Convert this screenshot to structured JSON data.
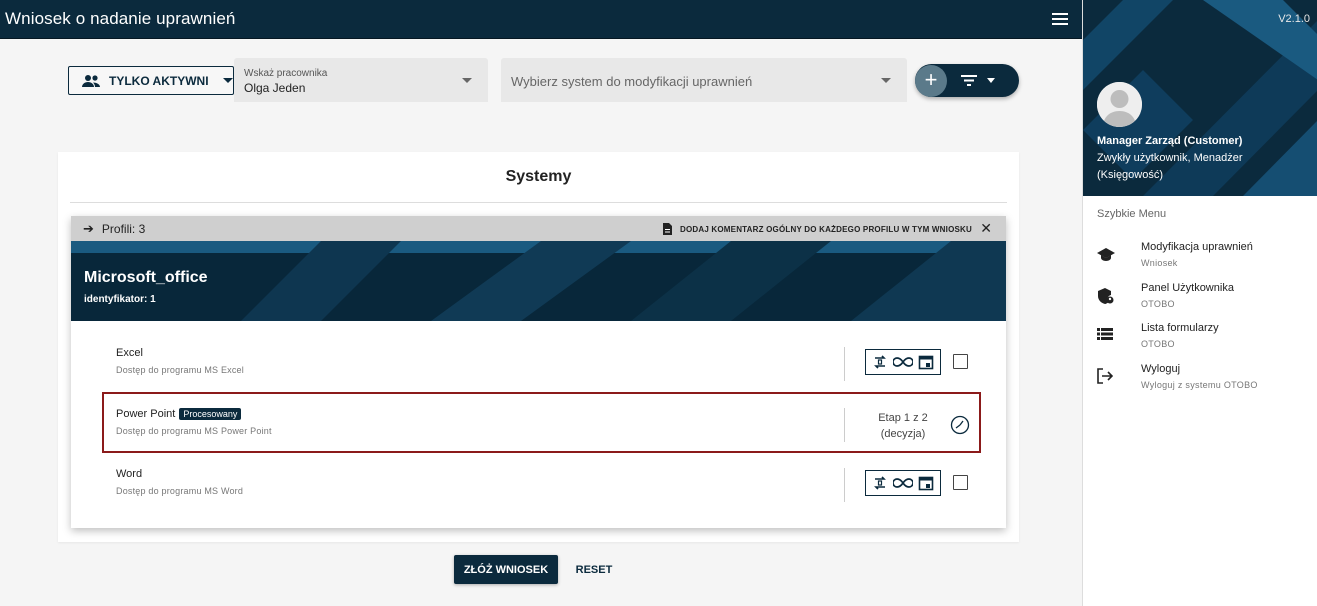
{
  "app": {
    "title": "Wniosek o nadanie uprawnień",
    "version": "V2.1.0"
  },
  "filters": {
    "active_only_label": "TYLKO AKTYWNI",
    "employee_label": "Wskaż pracownika",
    "employee_value": "Olga Jeden",
    "system_placeholder": "Wybierz system do modyfikacji uprawnień",
    "add_symbol": "+"
  },
  "card": {
    "heading": "Systemy",
    "panel": {
      "profiles_label": "Profili: 3",
      "comment_label": "DODAJ KOMENTARZ OGÓLNY DO KAŻDEGO PROFILU W TYM WNIOSKU",
      "close_symbol": "✕",
      "system_name": "Microsoft_office",
      "identifier": "identyfikator: 1",
      "profiles": [
        {
          "name": "Excel",
          "desc": "Dostęp do programu MS Excel"
        },
        {
          "name": "Power Point",
          "badge": "Procesowany",
          "desc": "Dostęp do programu MS Power Point",
          "stage_line1": "Etap 1 z 2",
          "stage_line2": "(decyzja)"
        },
        {
          "name": "Word",
          "desc": "Dostęp do programu MS Word"
        }
      ]
    }
  },
  "actions": {
    "submit_label": "ZŁÓŻ WNIOSEK",
    "reset_label": "RESET"
  },
  "sidebar": {
    "user_name": "Manager Zarząd (Customer)",
    "user_role_line1": "Zwykły użytkownik, Menadżer",
    "user_role_line2": "(Księgowość)",
    "quick_menu_label": "Szybkie Menu",
    "items": [
      {
        "label": "Modyfikacja uprawnień",
        "sub": "Wniosek",
        "icon": "graduation-cap-icon"
      },
      {
        "label": "Panel Użytkownika",
        "sub": "OTOBO",
        "icon": "shield-user-icon"
      },
      {
        "label": "Lista formularzy",
        "sub": "OTOBO",
        "icon": "list-icon"
      },
      {
        "label": "Wyloguj",
        "sub": "Wyloguj z systemu OTOBO",
        "icon": "logout-icon"
      }
    ]
  },
  "colors": {
    "primary": "#0b2a3d",
    "highlight_border": "#8b1a1a"
  }
}
